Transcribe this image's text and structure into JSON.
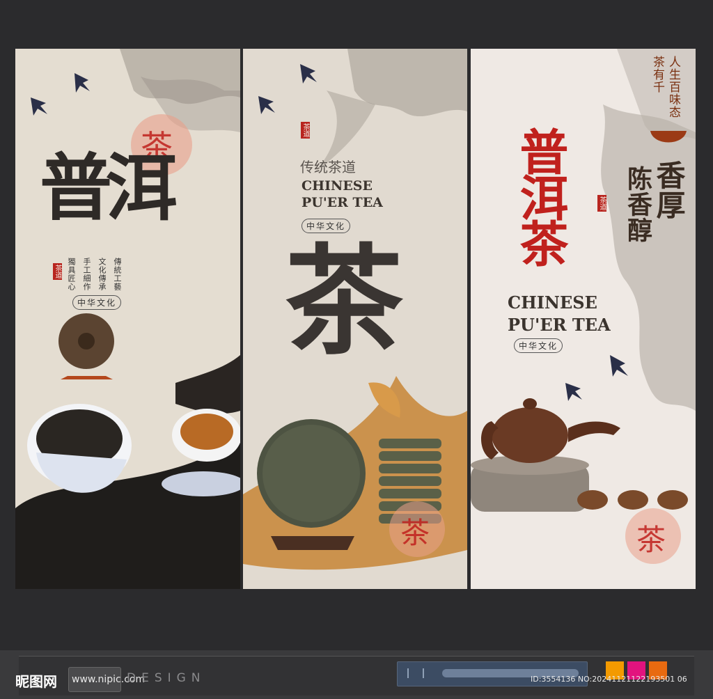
{
  "panel1": {
    "big_title": "普洱",
    "seal_char": "茶",
    "small_seal": "茶道",
    "columns": [
      "傳統工藝",
      "文化傳承",
      "手工細作",
      "獨具匠心"
    ],
    "badge": "中华文化"
  },
  "panel2": {
    "seal_small": "茶道",
    "subtitle_cn": "传统茶道",
    "en_line1": "CHINESE",
    "en_line2": "PU'ER TEA",
    "badge": "中华文化",
    "big_char": "茶",
    "seal_char": "茶"
  },
  "panel3": {
    "top_verse_col1": "人生百味态",
    "top_verse_col2": "茶有千",
    "title": "普洱茶",
    "side_title_col1": "香厚",
    "side_title_col2": "陈香醇",
    "small_seal": "茶道",
    "en_line1": "CHINESE",
    "en_line2": "PU'ER TEA",
    "badge": "中华文化",
    "seal_char": "茶"
  },
  "footer": {
    "logo_text": "昵图网",
    "url": "www.nipic.com",
    "design": "DESIGN",
    "id_text": "ID:3554136 NO:20241121122193501 06"
  },
  "colors": {
    "accent_red": "#c0211d",
    "ink": "#2e2a27",
    "swatch1": "#f39a00",
    "swatch2": "#e2137e",
    "swatch3": "#e86a10"
  }
}
